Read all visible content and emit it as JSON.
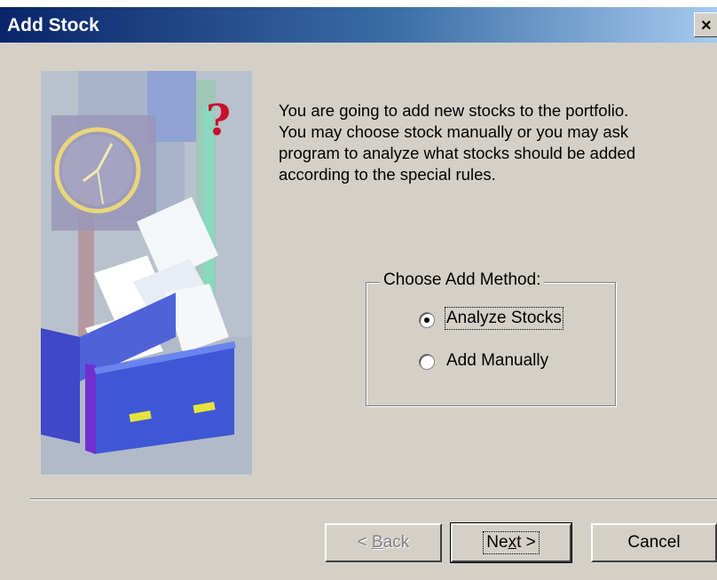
{
  "window": {
    "title": "Add Stock",
    "close_label": "×"
  },
  "intro_text": "You are going to add new stocks to the portfolio.\nYou may choose stock manually or you may ask\nprogram to analyze what stocks should be added\naccording to the special rules.",
  "method_group": {
    "label": "Choose Add Method:",
    "options": [
      {
        "label": "Analyze Stocks",
        "selected": true
      },
      {
        "label": "Add Manually",
        "selected": false
      }
    ]
  },
  "buttons": {
    "back": {
      "label": "< Back",
      "prefix": "< ",
      "accel": "B",
      "rest": "ack",
      "enabled": false
    },
    "next": {
      "label": "Next >",
      "pre": "Ne",
      "accel": "x",
      "post": "t >",
      "enabled": true
    },
    "cancel": {
      "label": "Cancel",
      "enabled": true
    }
  },
  "colors": {
    "titlebar_start": "#0a246a",
    "titlebar_end": "#a6caf0",
    "dialog_face": "#d4d0c8",
    "question_mark": "#c8102e"
  },
  "icons": {
    "illustration": "wizard-folder-clock-question-illustration",
    "close": "close-icon"
  }
}
